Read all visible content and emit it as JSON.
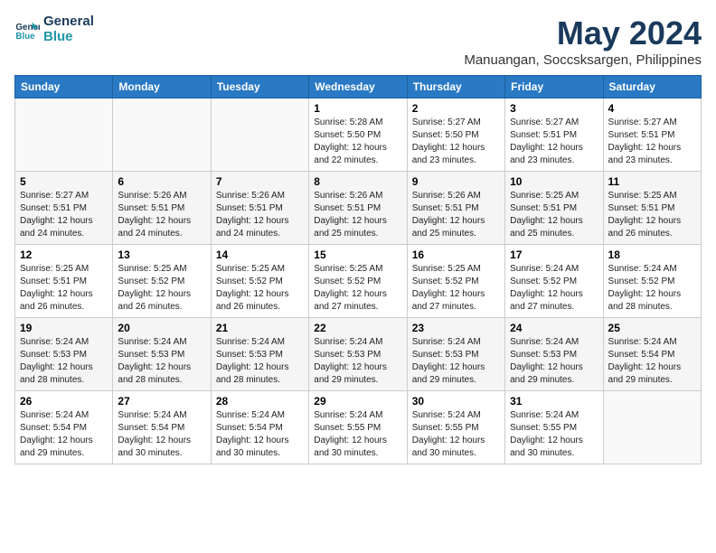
{
  "header": {
    "logo_line1": "General",
    "logo_line2": "Blue",
    "month_title": "May 2024",
    "location": "Manuangan, Soccsksargen, Philippines"
  },
  "weekdays": [
    "Sunday",
    "Monday",
    "Tuesday",
    "Wednesday",
    "Thursday",
    "Friday",
    "Saturday"
  ],
  "weeks": [
    [
      {
        "day": "",
        "sunrise": "",
        "sunset": "",
        "daylight": ""
      },
      {
        "day": "",
        "sunrise": "",
        "sunset": "",
        "daylight": ""
      },
      {
        "day": "",
        "sunrise": "",
        "sunset": "",
        "daylight": ""
      },
      {
        "day": "1",
        "sunrise": "Sunrise: 5:28 AM",
        "sunset": "Sunset: 5:50 PM",
        "daylight": "Daylight: 12 hours and 22 minutes."
      },
      {
        "day": "2",
        "sunrise": "Sunrise: 5:27 AM",
        "sunset": "Sunset: 5:50 PM",
        "daylight": "Daylight: 12 hours and 23 minutes."
      },
      {
        "day": "3",
        "sunrise": "Sunrise: 5:27 AM",
        "sunset": "Sunset: 5:51 PM",
        "daylight": "Daylight: 12 hours and 23 minutes."
      },
      {
        "day": "4",
        "sunrise": "Sunrise: 5:27 AM",
        "sunset": "Sunset: 5:51 PM",
        "daylight": "Daylight: 12 hours and 23 minutes."
      }
    ],
    [
      {
        "day": "5",
        "sunrise": "Sunrise: 5:27 AM",
        "sunset": "Sunset: 5:51 PM",
        "daylight": "Daylight: 12 hours and 24 minutes."
      },
      {
        "day": "6",
        "sunrise": "Sunrise: 5:26 AM",
        "sunset": "Sunset: 5:51 PM",
        "daylight": "Daylight: 12 hours and 24 minutes."
      },
      {
        "day": "7",
        "sunrise": "Sunrise: 5:26 AM",
        "sunset": "Sunset: 5:51 PM",
        "daylight": "Daylight: 12 hours and 24 minutes."
      },
      {
        "day": "8",
        "sunrise": "Sunrise: 5:26 AM",
        "sunset": "Sunset: 5:51 PM",
        "daylight": "Daylight: 12 hours and 25 minutes."
      },
      {
        "day": "9",
        "sunrise": "Sunrise: 5:26 AM",
        "sunset": "Sunset: 5:51 PM",
        "daylight": "Daylight: 12 hours and 25 minutes."
      },
      {
        "day": "10",
        "sunrise": "Sunrise: 5:25 AM",
        "sunset": "Sunset: 5:51 PM",
        "daylight": "Daylight: 12 hours and 25 minutes."
      },
      {
        "day": "11",
        "sunrise": "Sunrise: 5:25 AM",
        "sunset": "Sunset: 5:51 PM",
        "daylight": "Daylight: 12 hours and 26 minutes."
      }
    ],
    [
      {
        "day": "12",
        "sunrise": "Sunrise: 5:25 AM",
        "sunset": "Sunset: 5:51 PM",
        "daylight": "Daylight: 12 hours and 26 minutes."
      },
      {
        "day": "13",
        "sunrise": "Sunrise: 5:25 AM",
        "sunset": "Sunset: 5:52 PM",
        "daylight": "Daylight: 12 hours and 26 minutes."
      },
      {
        "day": "14",
        "sunrise": "Sunrise: 5:25 AM",
        "sunset": "Sunset: 5:52 PM",
        "daylight": "Daylight: 12 hours and 26 minutes."
      },
      {
        "day": "15",
        "sunrise": "Sunrise: 5:25 AM",
        "sunset": "Sunset: 5:52 PM",
        "daylight": "Daylight: 12 hours and 27 minutes."
      },
      {
        "day": "16",
        "sunrise": "Sunrise: 5:25 AM",
        "sunset": "Sunset: 5:52 PM",
        "daylight": "Daylight: 12 hours and 27 minutes."
      },
      {
        "day": "17",
        "sunrise": "Sunrise: 5:24 AM",
        "sunset": "Sunset: 5:52 PM",
        "daylight": "Daylight: 12 hours and 27 minutes."
      },
      {
        "day": "18",
        "sunrise": "Sunrise: 5:24 AM",
        "sunset": "Sunset: 5:52 PM",
        "daylight": "Daylight: 12 hours and 28 minutes."
      }
    ],
    [
      {
        "day": "19",
        "sunrise": "Sunrise: 5:24 AM",
        "sunset": "Sunset: 5:53 PM",
        "daylight": "Daylight: 12 hours and 28 minutes."
      },
      {
        "day": "20",
        "sunrise": "Sunrise: 5:24 AM",
        "sunset": "Sunset: 5:53 PM",
        "daylight": "Daylight: 12 hours and 28 minutes."
      },
      {
        "day": "21",
        "sunrise": "Sunrise: 5:24 AM",
        "sunset": "Sunset: 5:53 PM",
        "daylight": "Daylight: 12 hours and 28 minutes."
      },
      {
        "day": "22",
        "sunrise": "Sunrise: 5:24 AM",
        "sunset": "Sunset: 5:53 PM",
        "daylight": "Daylight: 12 hours and 29 minutes."
      },
      {
        "day": "23",
        "sunrise": "Sunrise: 5:24 AM",
        "sunset": "Sunset: 5:53 PM",
        "daylight": "Daylight: 12 hours and 29 minutes."
      },
      {
        "day": "24",
        "sunrise": "Sunrise: 5:24 AM",
        "sunset": "Sunset: 5:53 PM",
        "daylight": "Daylight: 12 hours and 29 minutes."
      },
      {
        "day": "25",
        "sunrise": "Sunrise: 5:24 AM",
        "sunset": "Sunset: 5:54 PM",
        "daylight": "Daylight: 12 hours and 29 minutes."
      }
    ],
    [
      {
        "day": "26",
        "sunrise": "Sunrise: 5:24 AM",
        "sunset": "Sunset: 5:54 PM",
        "daylight": "Daylight: 12 hours and 29 minutes."
      },
      {
        "day": "27",
        "sunrise": "Sunrise: 5:24 AM",
        "sunset": "Sunset: 5:54 PM",
        "daylight": "Daylight: 12 hours and 30 minutes."
      },
      {
        "day": "28",
        "sunrise": "Sunrise: 5:24 AM",
        "sunset": "Sunset: 5:54 PM",
        "daylight": "Daylight: 12 hours and 30 minutes."
      },
      {
        "day": "29",
        "sunrise": "Sunrise: 5:24 AM",
        "sunset": "Sunset: 5:55 PM",
        "daylight": "Daylight: 12 hours and 30 minutes."
      },
      {
        "day": "30",
        "sunrise": "Sunrise: 5:24 AM",
        "sunset": "Sunset: 5:55 PM",
        "daylight": "Daylight: 12 hours and 30 minutes."
      },
      {
        "day": "31",
        "sunrise": "Sunrise: 5:24 AM",
        "sunset": "Sunset: 5:55 PM",
        "daylight": "Daylight: 12 hours and 30 minutes."
      },
      {
        "day": "",
        "sunrise": "",
        "sunset": "",
        "daylight": ""
      }
    ]
  ]
}
